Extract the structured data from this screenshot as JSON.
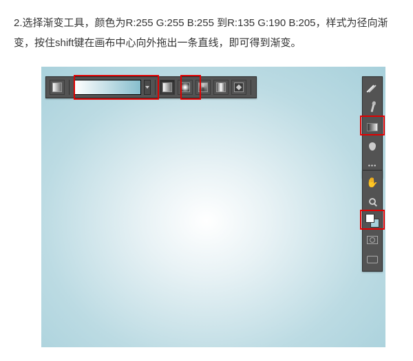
{
  "instruction": {
    "text": "2.选择渐变工具，颜色为R:255 G:255 B:255 到R:135 G:190 B:205，样式为径向渐变，按住shift键在画布中心向外拖出一条直线，即可得到渐变。"
  },
  "gradient": {
    "start": "R:255 G:255 B:255",
    "end": "R:135 G:190 B:205",
    "style": "径向渐变"
  },
  "tools": {
    "top": {
      "preview": "gradient-preview",
      "types": [
        "linear",
        "radial",
        "angle",
        "reflected",
        "diamond"
      ]
    },
    "right_group1": [
      "wand-icon",
      "brush-icon",
      "gradient-tool-icon",
      "drop-icon",
      "more-icon"
    ],
    "right_group2": [
      "hand-icon",
      "zoom-icon",
      "swatches-icon",
      "quickmask-icon",
      "screenmode-icon"
    ]
  },
  "highlights": {
    "top_gradient_preview": true,
    "top_radial_button": true,
    "right_gradient_tool": true,
    "right_swatches": true
  }
}
